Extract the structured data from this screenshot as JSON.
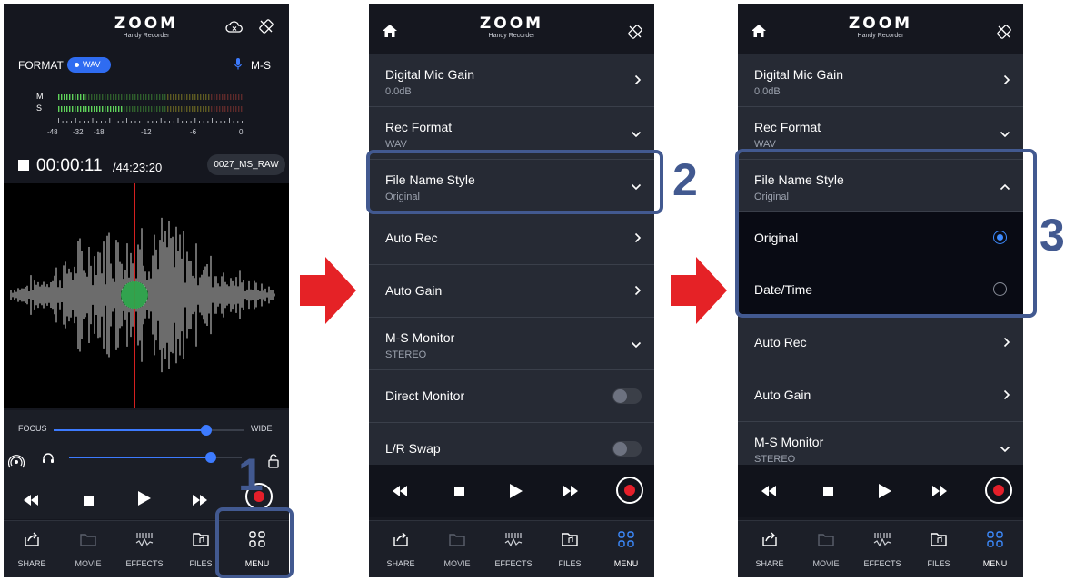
{
  "brand": {
    "logo": "ZOOM",
    "subtitle": "Handy Recorder"
  },
  "screen1": {
    "format_label": "FORMAT",
    "format_value": "WAV",
    "mic_mode": "M-S",
    "meter": {
      "channels": [
        "M",
        "S"
      ],
      "scale": [
        "-48",
        "-32",
        "-18",
        "-12",
        "-6",
        "0"
      ]
    },
    "elapsed_time": "00:00:11",
    "remaining_time": "/44:23:20",
    "file_name": "0027_MS_RAW",
    "focus_label": "FOCUS",
    "wide_label": "WIDE",
    "focus_slider_level": 0.8,
    "volume_slider_level": 0.82
  },
  "settings": {
    "digital_mic_gain": {
      "label": "Digital Mic Gain",
      "value": "0.0dB"
    },
    "rec_format": {
      "label": "Rec Format",
      "value": "WAV"
    },
    "file_name_style": {
      "label": "File Name Style",
      "value": "Original"
    },
    "auto_rec": {
      "label": "Auto Rec"
    },
    "auto_gain": {
      "label": "Auto Gain"
    },
    "ms_monitor": {
      "label": "M-S Monitor",
      "value": "STEREO"
    },
    "direct_monitor": {
      "label": "Direct Monitor"
    },
    "lr_swap": {
      "label": "L/R Swap"
    },
    "options": [
      {
        "label": "Original",
        "selected": true
      },
      {
        "label": "Date/Time",
        "selected": false
      }
    ]
  },
  "tabs": [
    {
      "label": "SHARE",
      "icon": "share-icon"
    },
    {
      "label": "MOVIE",
      "icon": "movie-icon"
    },
    {
      "label": "EFFECTS",
      "icon": "effects-icon"
    },
    {
      "label": "FILES",
      "icon": "files-icon"
    },
    {
      "label": "MENU",
      "icon": "menu-icon"
    }
  ],
  "steps": [
    "1",
    "2",
    "3"
  ],
  "colors": {
    "accent": "#2f6cf1",
    "record": "#e51f2a",
    "callout": "#425990",
    "arrow": "#e52226",
    "playhead": "#d42020",
    "focus_dot": "#2aa84a"
  }
}
